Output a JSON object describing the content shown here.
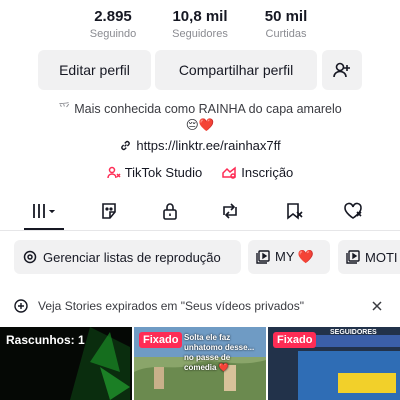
{
  "stats": [
    {
      "value": "2.895",
      "label": "Seguindo"
    },
    {
      "value": "10,8 mil",
      "label": "Seguidores"
    },
    {
      "value": "50 mil",
      "label": "Curtidas"
    }
  ],
  "actions": {
    "edit_profile": "Editar perfil",
    "share_profile": "Compartilhar perfil",
    "add_friend_icon": "person-plus-icon"
  },
  "bio": {
    "line1": "Mais conhecida como RAINHA do capa amarelo",
    "line2": "😔❤️"
  },
  "link": "https://linktr.ee/rainhax7ff",
  "tools": {
    "studio": "TikTok Studio",
    "subscription": "Inscrição"
  },
  "tabs": [
    {
      "icon": "grid-icon",
      "active": true
    },
    {
      "icon": "sticker-icon",
      "active": false
    },
    {
      "icon": "lock-icon",
      "active": false
    },
    {
      "icon": "repost-icon",
      "active": false
    },
    {
      "icon": "bookmark-hidden-icon",
      "active": false
    },
    {
      "icon": "heart-hidden-icon",
      "active": false
    }
  ],
  "playlists": {
    "manage": "Gerenciar listas de reprodução",
    "items": [
      "MY ❤️",
      "MOTI"
    ]
  },
  "stories_banner": "Veja Stories expirados em \"Seus vídeos privados\"",
  "thumbnails": [
    {
      "label": "Rascunhos: 1"
    },
    {
      "label": "Fixado",
      "caption": "Solta ele faz\nunhatomo desse...\nno passe de comedia ❤️"
    },
    {
      "label": "Fixado",
      "caption": "SEGUIDORES"
    }
  ],
  "colors": {
    "accent": "#fe2c55",
    "text": "#161823",
    "muted": "#8a8b91",
    "button_bg": "#f1f1f2"
  }
}
